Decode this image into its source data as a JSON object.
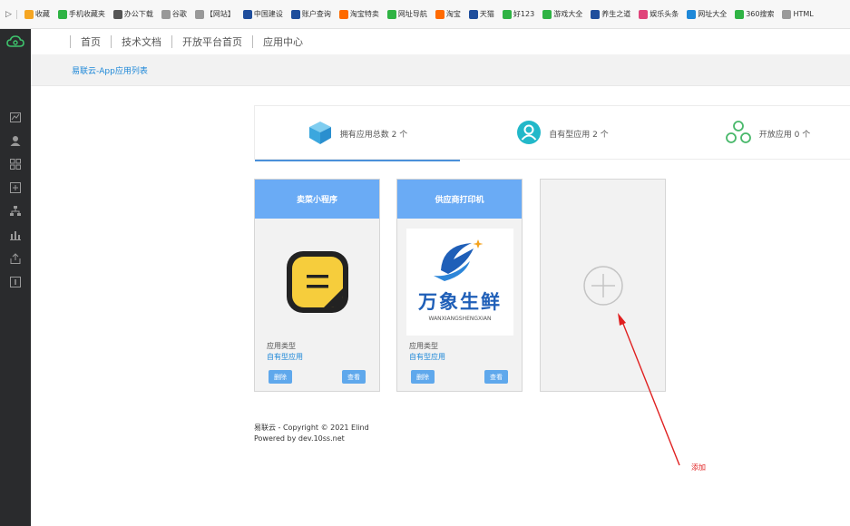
{
  "bookmarks": [
    {
      "label": "收藏",
      "icon": "star-icon",
      "color": "#f5a623"
    },
    {
      "label": "手机收藏夹",
      "icon": "phone-icon",
      "color": "#2fb344"
    },
    {
      "label": "办公下载",
      "icon": "download-icon",
      "color": "#555555"
    },
    {
      "label": "谷歌",
      "icon": "page-icon",
      "color": "#999999"
    },
    {
      "label": "【网站】",
      "icon": "page-icon",
      "color": "#999999"
    },
    {
      "label": "中国建设",
      "icon": "bank-icon",
      "color": "#1f4e9c"
    },
    {
      "label": "账户查询",
      "icon": "bank-icon",
      "color": "#1f4e9c"
    },
    {
      "label": "淘宝特卖",
      "icon": "shop-icon",
      "color": "#ff6a00"
    },
    {
      "label": "网址导航",
      "icon": "nav-icon",
      "color": "#2fb344"
    },
    {
      "label": "淘宝",
      "icon": "shop-icon",
      "color": "#ff6a00"
    },
    {
      "label": "天猫",
      "icon": "tmall-icon",
      "color": "#1f4e9c"
    },
    {
      "label": "好123",
      "icon": "hao-icon",
      "color": "#2fb344"
    },
    {
      "label": "游戏大全",
      "icon": "game-icon",
      "color": "#2fb344"
    },
    {
      "label": "养生之道",
      "icon": "health-icon",
      "color": "#1f4e9c"
    },
    {
      "label": "娱乐头条",
      "icon": "ent-icon",
      "color": "#e0457b"
    },
    {
      "label": "网址大全",
      "icon": "nav-icon",
      "color": "#1e88d8"
    },
    {
      "label": "360搜索",
      "icon": "search-icon",
      "color": "#2fb344"
    },
    {
      "label": "HTML",
      "icon": "page-icon",
      "color": "#999999"
    }
  ],
  "topnav": {
    "items": [
      "首页",
      "技术文档",
      "开放平台首页",
      "应用中心"
    ]
  },
  "breadcrumb": "易联云-App应用列表",
  "stats": {
    "total": "拥有应用总数 2 个",
    "own": "自有型应用 2 个",
    "open": "开放应用 0 个"
  },
  "apps": [
    {
      "name": "卖菜小程序",
      "type_label": "应用类型",
      "type_value": "自有型应用",
      "delete_label": "删除",
      "view_label": "查看"
    },
    {
      "name": "供应商打印机",
      "type_label": "应用类型",
      "type_value": "自有型应用",
      "delete_label": "删除",
      "view_label": "查看",
      "logo_text": "万象生鲜",
      "logo_sub": "WANXIANGSHENGXIAN"
    }
  ],
  "footer": {
    "copyright": "易联云 - Copyright © 2021 Elind",
    "powered": "Powered by dev.10ss.net"
  },
  "annotation": "添加",
  "colors": {
    "sidebar": "#2a2b2d",
    "card_header": "#6aabf5",
    "button": "#5fa8ec",
    "link": "#1e88d8",
    "annotation": "#e02020"
  }
}
